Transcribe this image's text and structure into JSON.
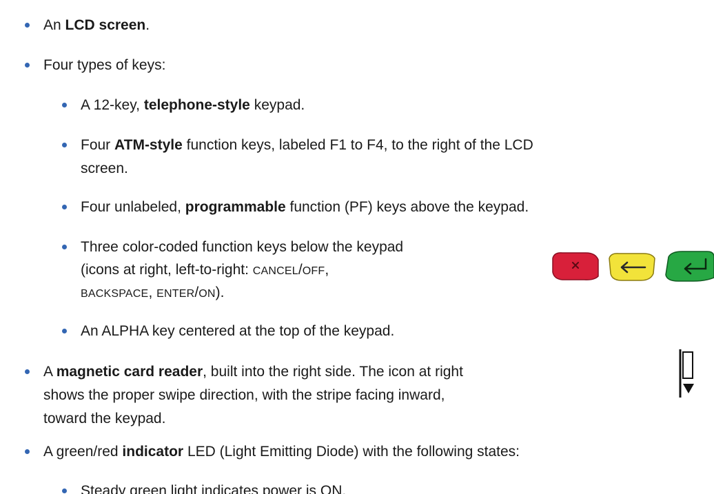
{
  "items": [
    {
      "parts": [
        {
          "t": "An "
        },
        {
          "t": "LCD screen",
          "b": true
        },
        {
          "t": "."
        }
      ]
    },
    {
      "parts": [
        {
          "t": "Four types of keys:"
        }
      ]
    },
    {
      "parts": [
        {
          "t": "A 12-key, "
        },
        {
          "t": "telephone-style",
          "b": true
        },
        {
          "t": " keypad."
        }
      ]
    },
    {
      "parts": [
        {
          "t": "Four "
        },
        {
          "t": "ATM-style",
          "b": true
        },
        {
          "t": " function keys, labeled F1 to F4, to the right of the LCD"
        }
      ]
    },
    {
      "parts": [
        {
          "t": "screen."
        }
      ]
    },
    {
      "parts": [
        {
          "t": "Four unlabeled, "
        },
        {
          "t": "programmable",
          "b": true
        },
        {
          "t": " function (PF) keys above the keypad."
        }
      ]
    },
    {
      "parts": [
        {
          "t": "Three color-coded function keys below the keypad"
        }
      ]
    },
    {
      "parts": [
        {
          "t": "(icons at right, left-to-right: "
        },
        {
          "t": "CANCEL",
          "sc": true
        },
        {
          "t": "/"
        },
        {
          "t": "OFF",
          "sc": true
        },
        {
          "t": ","
        }
      ]
    },
    {
      "parts": [
        {
          "t": "BACKSPACE",
          "sc": true
        },
        {
          "t": ", "
        },
        {
          "t": "ENTER",
          "sc": true
        },
        {
          "t": "/"
        },
        {
          "t": "ON",
          "sc": true
        },
        {
          "t": ")."
        }
      ]
    },
    {
      "parts": [
        {
          "t": "An ALPHA key centered at the top of the keypad."
        }
      ]
    },
    {
      "parts": [
        {
          "t": "A "
        },
        {
          "t": "magnetic card reader",
          "b": true
        },
        {
          "t": ", built into the right side. The icon at right"
        }
      ]
    },
    {
      "parts": [
        {
          "t": "shows the proper swipe direction, with the stripe facing inward,"
        }
      ]
    },
    {
      "parts": [
        {
          "t": "toward the keypad."
        }
      ]
    },
    {
      "parts": [
        {
          "t": "A green/red "
        },
        {
          "t": "indicator",
          "b": true
        },
        {
          "t": " LED (Light Emitting Diode) with the following states:"
        }
      ]
    },
    {
      "parts": [
        {
          "t": "Steady green light indicates power is ON."
        }
      ]
    }
  ],
  "key_icons": [
    {
      "name": "cancel-off-key-icon",
      "color": "#d8203a",
      "glyph": "×"
    },
    {
      "name": "backspace-key-icon",
      "color": "#f2e33a",
      "glyph": "←"
    },
    {
      "name": "enter-on-key-icon",
      "color": "#27a844",
      "glyph": "↵"
    }
  ],
  "bullet_color": "#3366b3"
}
